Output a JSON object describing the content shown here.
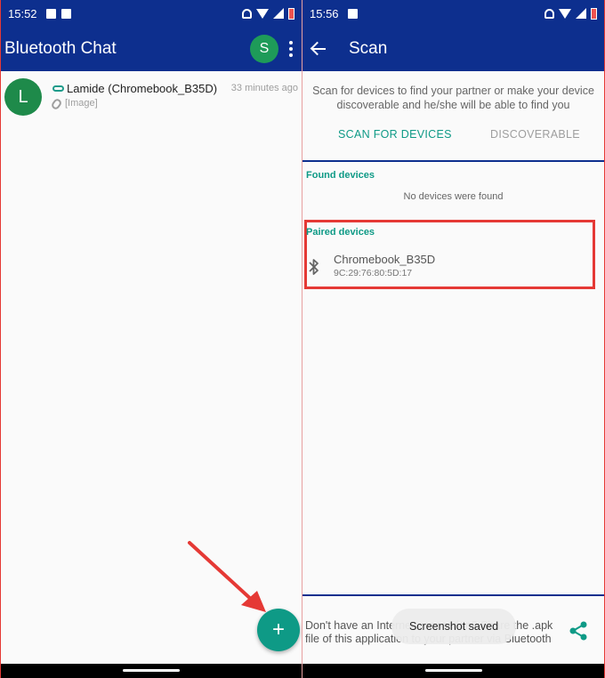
{
  "left": {
    "status_time": "15:52",
    "app_title": "Bluetooth Chat",
    "profile_initial": "S",
    "chat": {
      "avatar_initial": "L",
      "name": "Lamide (Chromebook_B35D)",
      "time": "33 minutes ago",
      "preview": "[Image]",
      "link_icon": "link-icon",
      "attachment_icon": "paperclip-icon"
    },
    "fab_label": "+"
  },
  "right": {
    "status_time": "15:56",
    "title": "Scan",
    "description": "Scan for devices to find your partner or make your device discoverable and he/she will be able to find you",
    "tabs": {
      "scan": "SCAN FOR DEVICES",
      "discoverable": "DISCOVERABLE"
    },
    "found_label": "Found devices",
    "no_devices": "No devices were found",
    "paired_label": "Paired devices",
    "paired_device": {
      "name": "Chromebook_B35D",
      "mac": "9C:29:76:80:5D:17",
      "icon": "bluetooth-icon"
    },
    "bottom_text": "Don't have an Internet connection? Share the .apk file of this application to your partner via Bluetooth",
    "toast": "Screenshot saved",
    "share_icon": "share-icon"
  },
  "colors": {
    "primary": "#0d2f8e",
    "accent": "#0e9a86",
    "annotation": "#e53935",
    "avatar_green": "#1e9b59"
  }
}
